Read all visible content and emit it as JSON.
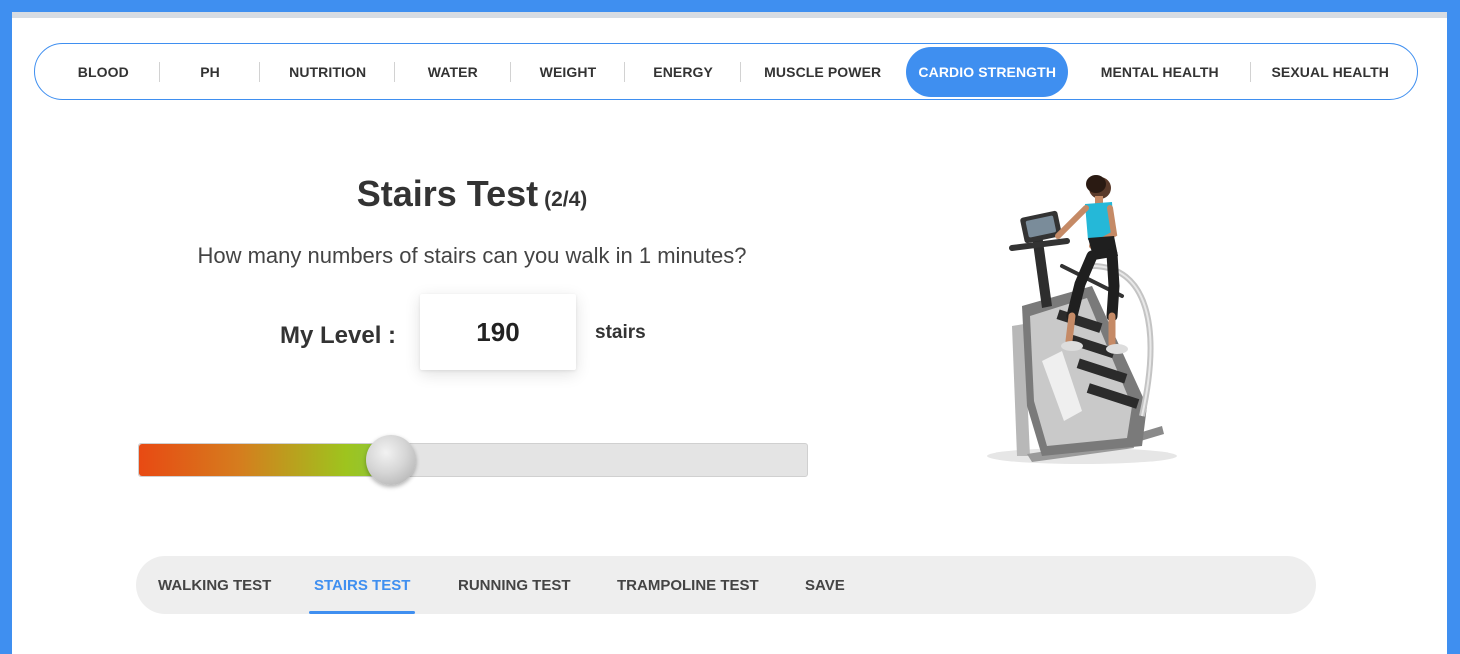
{
  "category_nav": {
    "items": [
      {
        "label": "BLOOD"
      },
      {
        "label": "PH"
      },
      {
        "label": "NUTRITION"
      },
      {
        "label": "WATER"
      },
      {
        "label": "WEIGHT"
      },
      {
        "label": "ENERGY"
      },
      {
        "label": "MUSCLE POWER"
      },
      {
        "label": "CARDIO STRENGTH",
        "active": true
      },
      {
        "label": "MENTAL HEALTH"
      },
      {
        "label": "SEXUAL HEALTH"
      }
    ]
  },
  "test": {
    "title": "Stairs Test",
    "step": "(2/4)",
    "question": "How many numbers of stairs can you walk in 1 minutes?",
    "level_label": "My Level :",
    "level_value": "190",
    "unit": "stairs",
    "slider_fraction": 0.377
  },
  "sub_tabs": {
    "items": [
      {
        "label": "WALKING TEST"
      },
      {
        "label": "STAIRS TEST",
        "active": true
      },
      {
        "label": "RUNNING TEST"
      },
      {
        "label": "TRAMPOLINE TEST"
      },
      {
        "label": "SAVE"
      }
    ]
  },
  "colors": {
    "accent": "#3f8ff0",
    "slider_start": "#e84a13",
    "slider_end": "#8cc63f"
  },
  "illustration": {
    "icon": "stair-climber-machine-icon"
  }
}
